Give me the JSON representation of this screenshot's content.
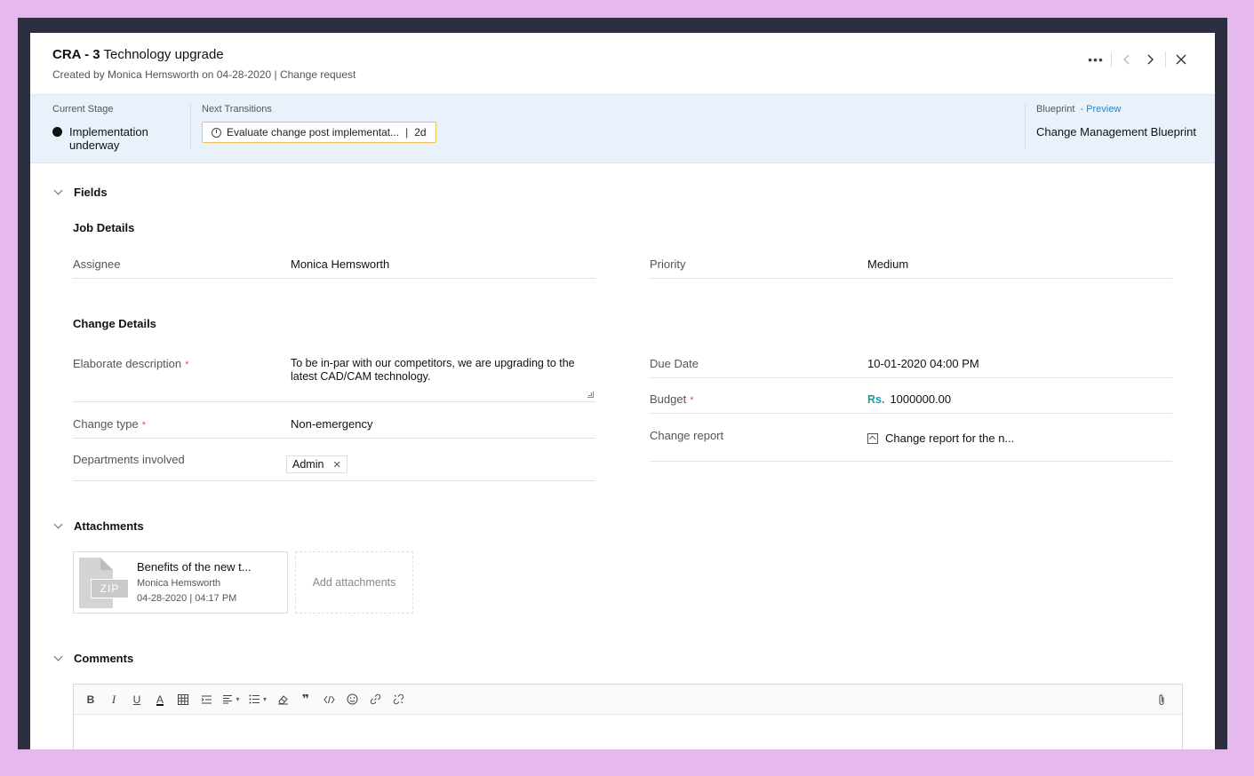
{
  "header": {
    "code": "CRA - 3",
    "title": "Technology upgrade",
    "created_prefix": "Created by",
    "creator": "Monica Hemsworth",
    "created_on": "on 04-28-2020",
    "type": "| Change request",
    "more_icon": "more-horizontal-icon",
    "prev_icon": "chevron-left-icon",
    "next_icon": "chevron-right-icon",
    "close_icon": "close-icon"
  },
  "stage": {
    "current_label": "Current Stage",
    "current_value": "Implementation underway",
    "next_label": "Next Transitions",
    "transition_label": "Evaluate change post implementat...",
    "transition_duration": "2d",
    "blueprint_label": "Blueprint",
    "blueprint_preview": "- Preview",
    "blueprint_value": "Change Management Blueprint"
  },
  "fields": {
    "section_title": "Fields",
    "job_details_title": "Job Details",
    "assignee_label": "Assignee",
    "assignee_value": "Monica Hemsworth",
    "priority_label": "Priority",
    "priority_value": "Medium",
    "change_details_title": "Change Details",
    "description_label": "Elaborate description",
    "description_value": "To be in-par with our competitors, we are upgrading to the latest CAD/CAM technology.",
    "due_date_label": "Due Date",
    "due_date_value": "10-01-2020 04:00 PM",
    "budget_label": "Budget",
    "budget_currency": "Rs.",
    "budget_value": "1000000.00",
    "change_type_label": "Change type",
    "change_type_value": "Non-emergency",
    "change_report_label": "Change report",
    "change_report_value": "Change report for the n...",
    "departments_label": "Departments involved",
    "department_tag": "Admin",
    "required_mark": "*"
  },
  "attachments": {
    "section_title": "Attachments",
    "file_type": "ZIP",
    "file_name": "Benefits of the new t...",
    "file_owner": "Monica Hemsworth",
    "file_date": "04-28-2020 | 04:17 PM",
    "add_label": "Add attachments"
  },
  "comments": {
    "section_title": "Comments",
    "toolbar": {
      "bold": "B",
      "italic": "I",
      "underline": "U",
      "font_color": "A"
    }
  },
  "colors": {
    "accent": "#2b86c5",
    "stage_bg": "#e9f2fb",
    "transition_border": "#e9c35a",
    "currency": "#1a9aa8",
    "required": "#e05050"
  }
}
